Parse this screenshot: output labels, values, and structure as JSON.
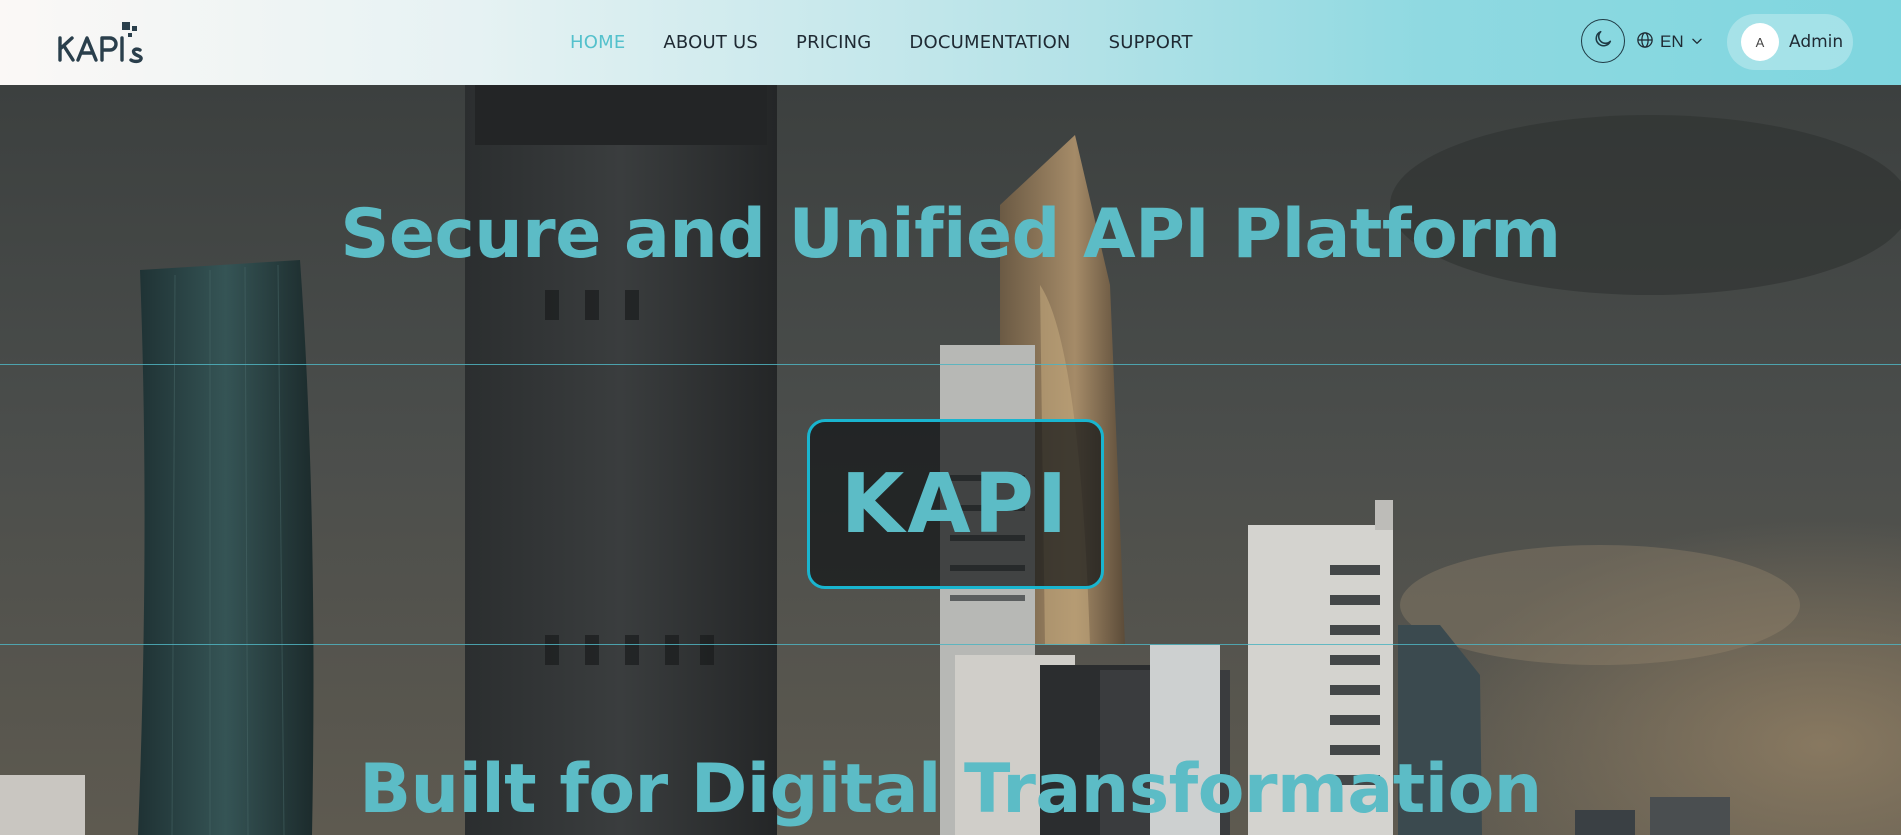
{
  "header": {
    "logo_text": "KAPIs",
    "nav": [
      {
        "label": "HOME",
        "active": true
      },
      {
        "label": "ABOUT US",
        "active": false
      },
      {
        "label": "PRICING",
        "active": false
      },
      {
        "label": "DOCUMENTATION",
        "active": false
      },
      {
        "label": "SUPPORT",
        "active": false
      }
    ],
    "theme_icon": "moon-icon",
    "language": {
      "icon": "globe-icon",
      "label": "EN",
      "chevron": "chevron-down-icon"
    },
    "user": {
      "avatar_initial": "A",
      "name": "Admin"
    }
  },
  "hero": {
    "title": "Secure and Unified API Platform",
    "badge": "KAPI",
    "subtitle": "Built for Digital Transformation"
  },
  "colors": {
    "accent": "#5cbcc6",
    "badge_border": "#19b5cf",
    "nav_text": "#1f2a33"
  }
}
